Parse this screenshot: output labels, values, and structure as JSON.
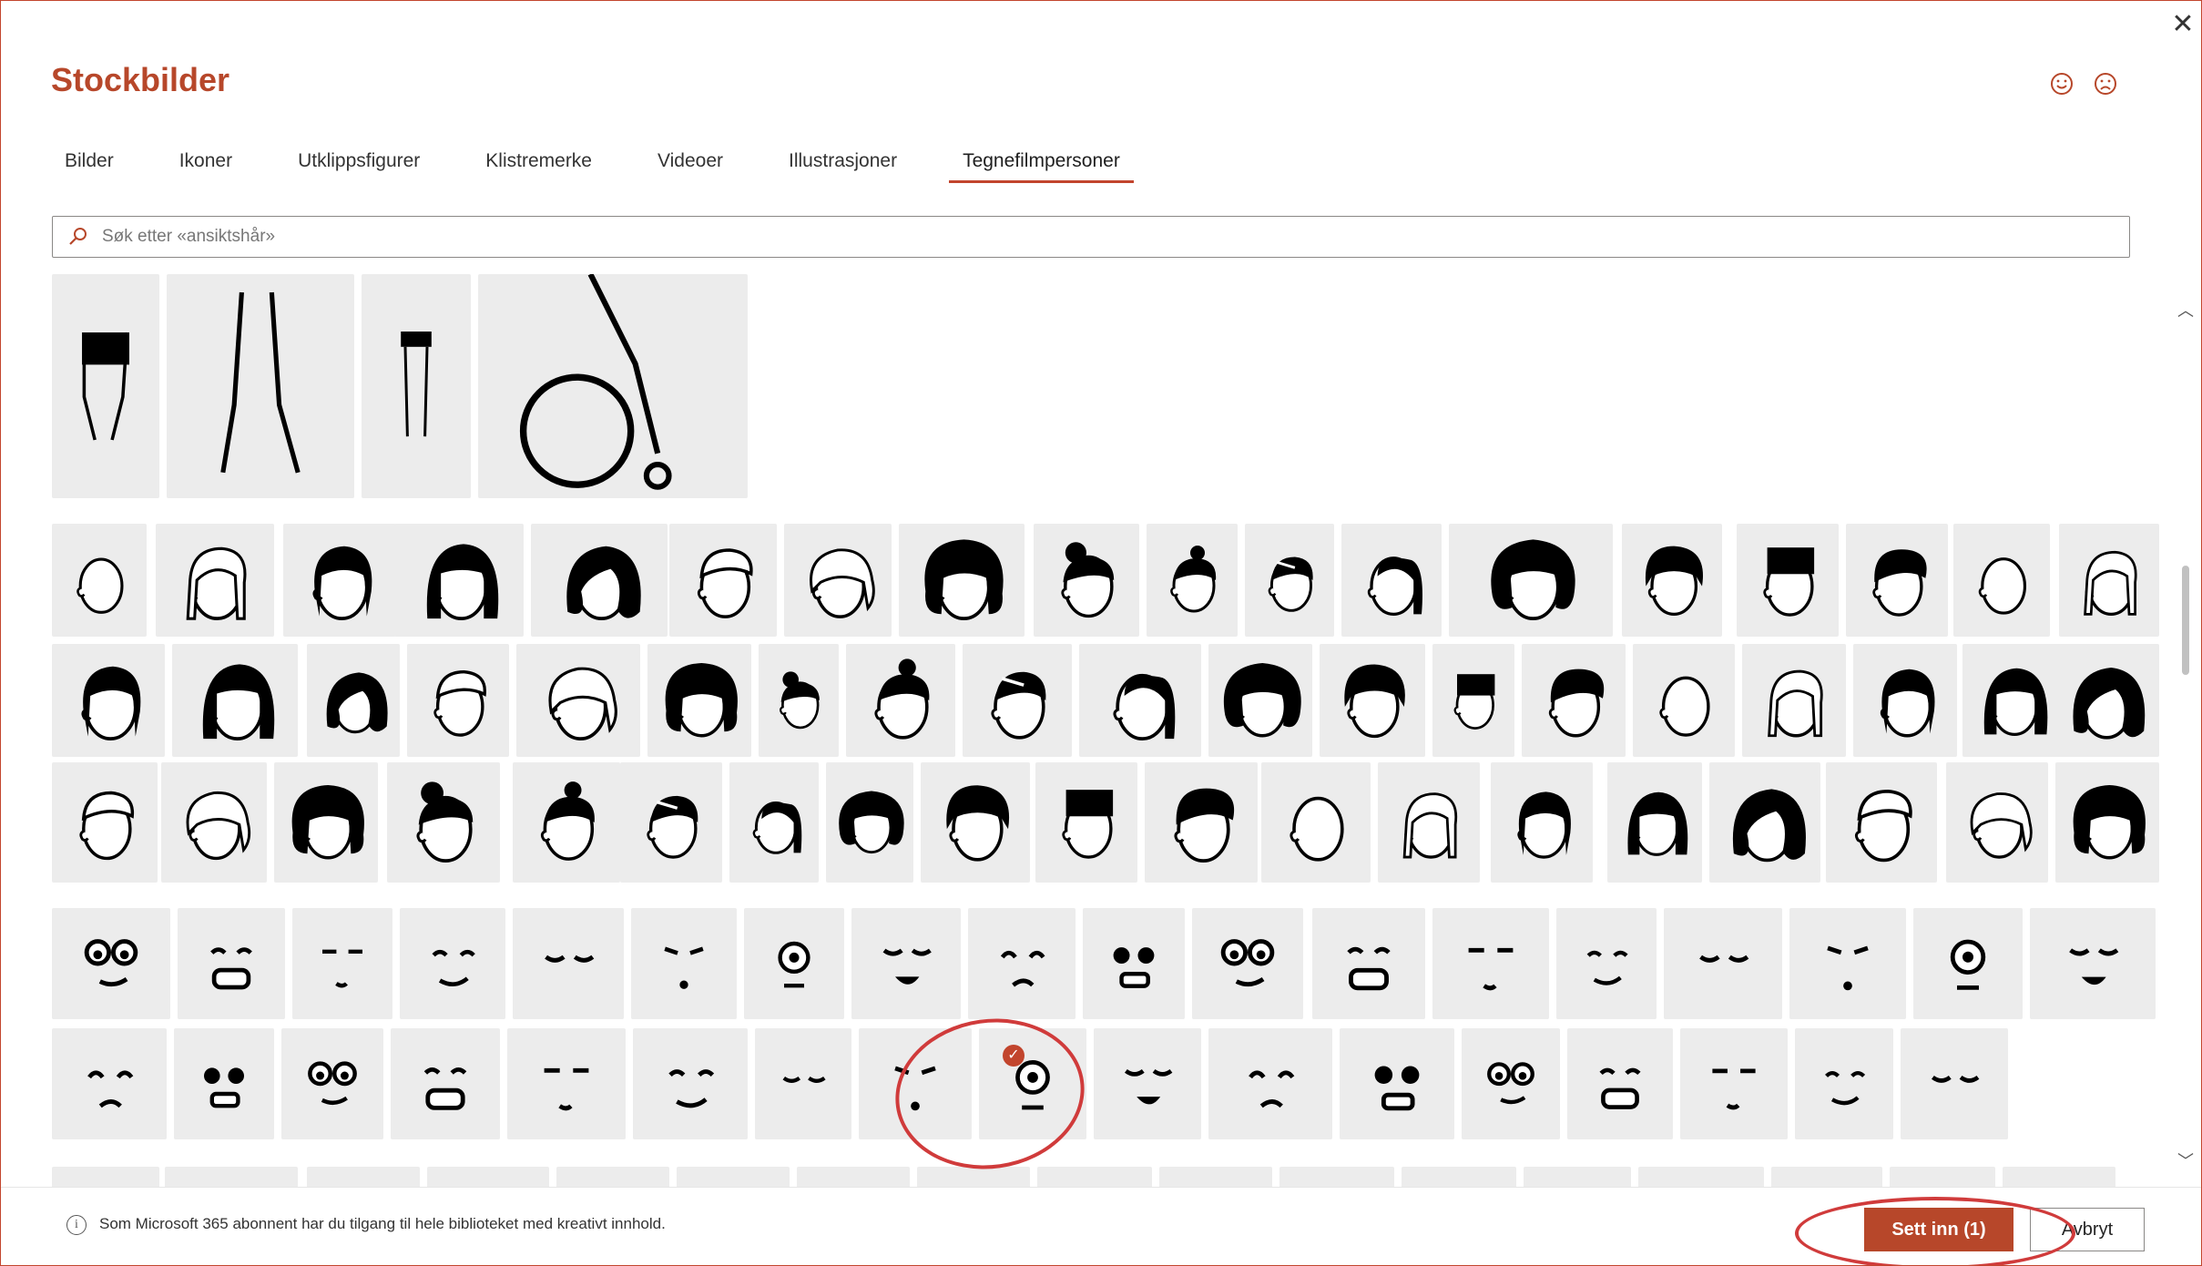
{
  "dialog": {
    "title": "Stockbilder",
    "close_icon": "close-icon"
  },
  "feedback": {
    "smile_icon": "smile-icon",
    "frown_icon": "frown-icon"
  },
  "tabs": [
    {
      "label": "Bilder",
      "active": false
    },
    {
      "label": "Ikoner",
      "active": false
    },
    {
      "label": "Utklippsfigurer",
      "active": false
    },
    {
      "label": "Klistremerke",
      "active": false
    },
    {
      "label": "Videoer",
      "active": false
    },
    {
      "label": "Illustrasjoner",
      "active": false
    },
    {
      "label": "Tegnefilmpersoner",
      "active": true
    }
  ],
  "search": {
    "placeholder": "Søk etter «ansiktshår»",
    "value": ""
  },
  "gallery": {
    "selected_item": "hair-style-8-row-3",
    "sections": [
      "bodies",
      "hair-styles",
      "faces",
      "more"
    ]
  },
  "footer": {
    "info_text": "Som Microsoft 365 abonnent har du tilgang til hele biblioteket med kreativt innhold.",
    "insert_label": "Sett inn (1)",
    "cancel_label": "Avbryt"
  },
  "colors": {
    "accent": "#b7472a",
    "tile_bg": "#ececec",
    "highlight": "#d03b3b"
  }
}
